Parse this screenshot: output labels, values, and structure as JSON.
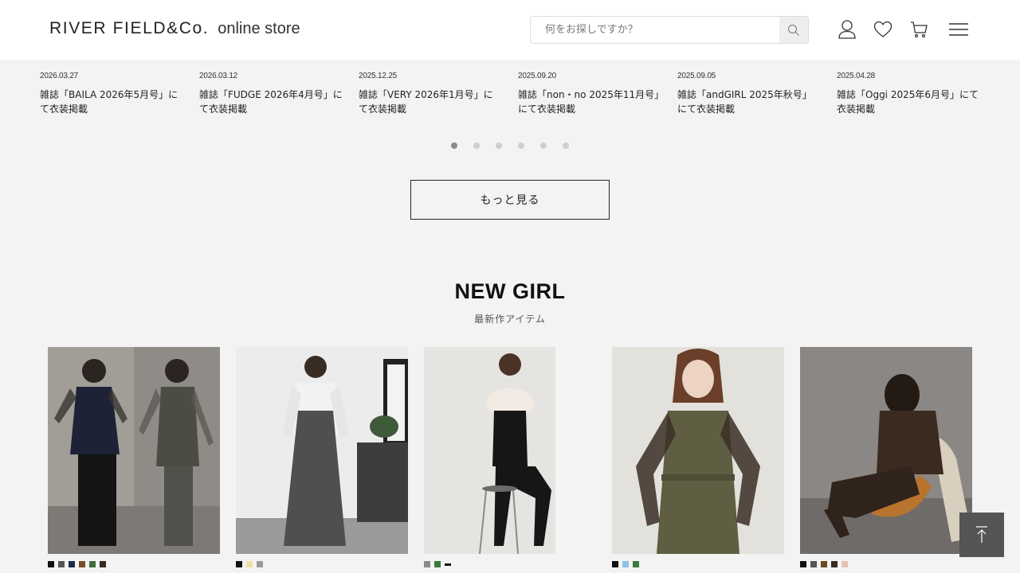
{
  "header": {
    "logo_main": "RIVER FIELD&Co.",
    "logo_sub": "online store",
    "search_placeholder": "何をお探しですか？"
  },
  "news": [
    {
      "date": "2026.03.27",
      "title": "雑誌「BAILA 2026年5月号」にて衣装掲載"
    },
    {
      "date": "2026.03.12",
      "title": "雑誌「FUDGE 2026年4月号」にて衣装掲載"
    },
    {
      "date": "2025.12.25",
      "title": "雑誌「VERY 2026年1月号」にて衣装掲載"
    },
    {
      "date": "2025.09.20",
      "title": "雑誌「non・no 2025年11月号」にて衣装掲載"
    },
    {
      "date": "2025.09.05",
      "title": "雑誌「andGIRL 2025年秋号」にて衣装掲載"
    },
    {
      "date": "2025.04.28",
      "title": "雑誌「Oggi 2025年6月号」にて衣装掲載"
    }
  ],
  "carousel": {
    "dots": 6,
    "active": 1
  },
  "more_label": "もっと見る",
  "section": {
    "title": "NEW GIRL",
    "subtitle": "最新作アイテム"
  },
  "products": [
    {
      "swatches": [
        "#111111",
        "#555555",
        "#1f2a4a",
        "#7a4e24",
        "#3d6e3a",
        "#3a2a1e"
      ]
    },
    {
      "swatches": [
        "#111111",
        "#f3e0a8",
        "#9a9a9a"
      ]
    },
    {
      "swatches": [
        "#8a8a8a",
        "#3d7a3d",
        "#111111"
      ]
    },
    {
      "swatches": [
        "#111111",
        "#8cc2ea",
        "#3d7a3d"
      ]
    },
    {
      "swatches": [
        "#111111",
        "#555555",
        "#6b4a24",
        "#3a2a1e",
        "#e8c0b4"
      ]
    }
  ],
  "colors": {
    "background": "#f3f3f3",
    "header": "#ffffff",
    "to_top": "#555555"
  }
}
